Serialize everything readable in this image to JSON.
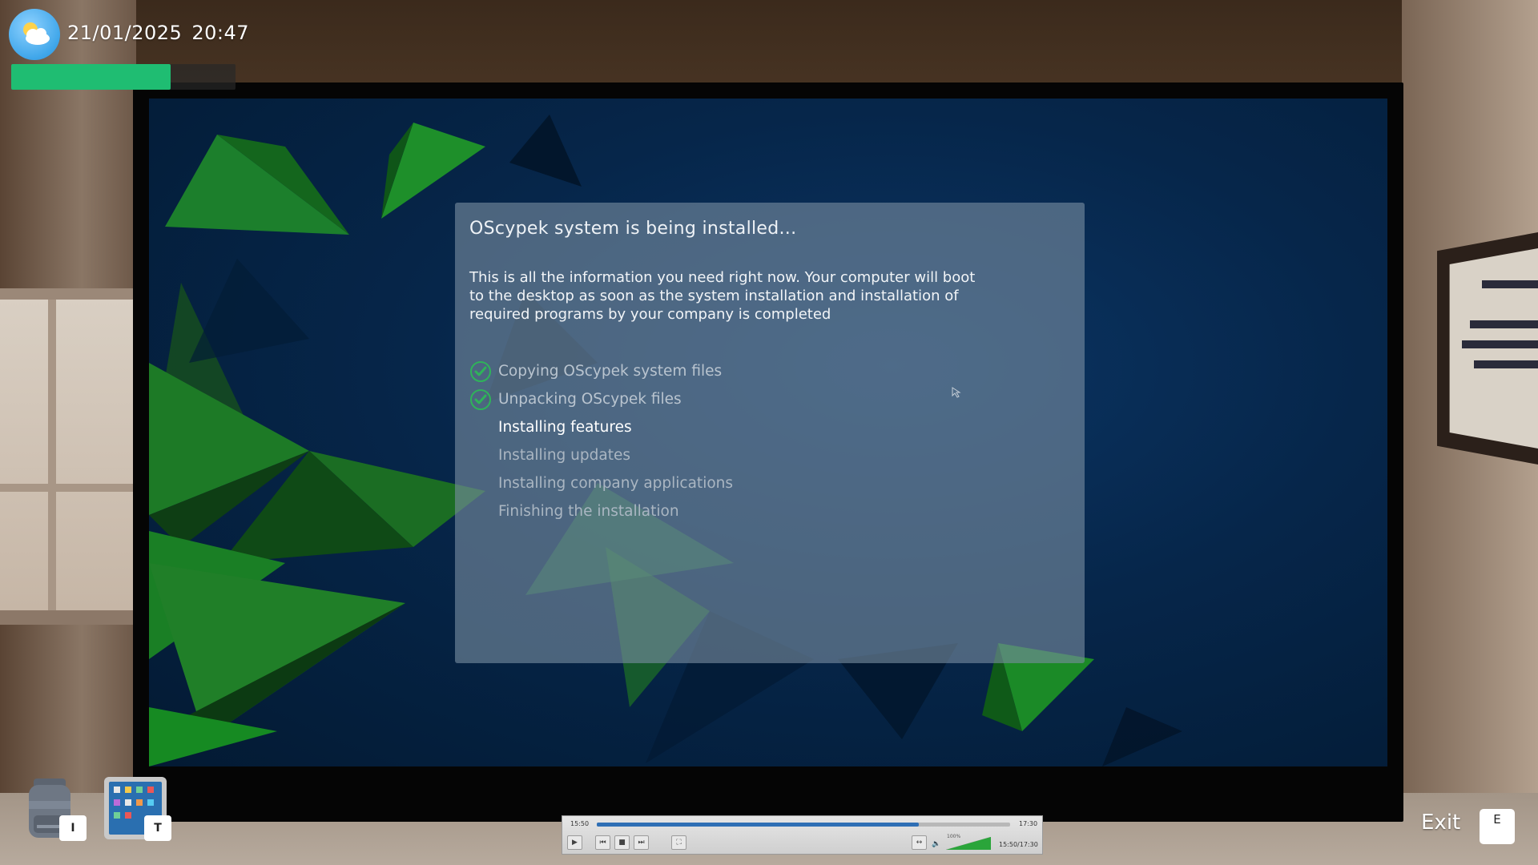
{
  "hud": {
    "date": "21/01/2025",
    "time": "20:47",
    "weather_icon": "partly-cloudy-icon",
    "energy_level": 0.71,
    "energy_color": "#1fbd72"
  },
  "installer": {
    "title": "OScypek system is being installed...",
    "description": "This is all the information you need right now. Your computer will boot to the desktop as soon as the system installation and installation of required programs by your company is completed",
    "steps": [
      {
        "label": "Copying OScypek system files",
        "status": "done"
      },
      {
        "label": "Unpacking OScypek files",
        "status": "done"
      },
      {
        "label": "Installing features",
        "status": "active"
      },
      {
        "label": "Installing updates",
        "status": "pending"
      },
      {
        "label": "Installing company applications",
        "status": "pending"
      },
      {
        "label": "Finishing the installation",
        "status": "pending"
      }
    ],
    "check_color": "#2fb35a"
  },
  "inventory": {
    "backpack_key": "I",
    "tablet_key": "T"
  },
  "exit": {
    "label": "Exit",
    "key": "E"
  },
  "player": {
    "start_time": "15:50",
    "end_time": "17:30",
    "time_readout": "15:50/17:30",
    "volume_label": "100%",
    "progress": 0.78,
    "volume_level": 1.0,
    "seek_color": "#2f6fb5",
    "volume_color": "#2aa53a"
  }
}
